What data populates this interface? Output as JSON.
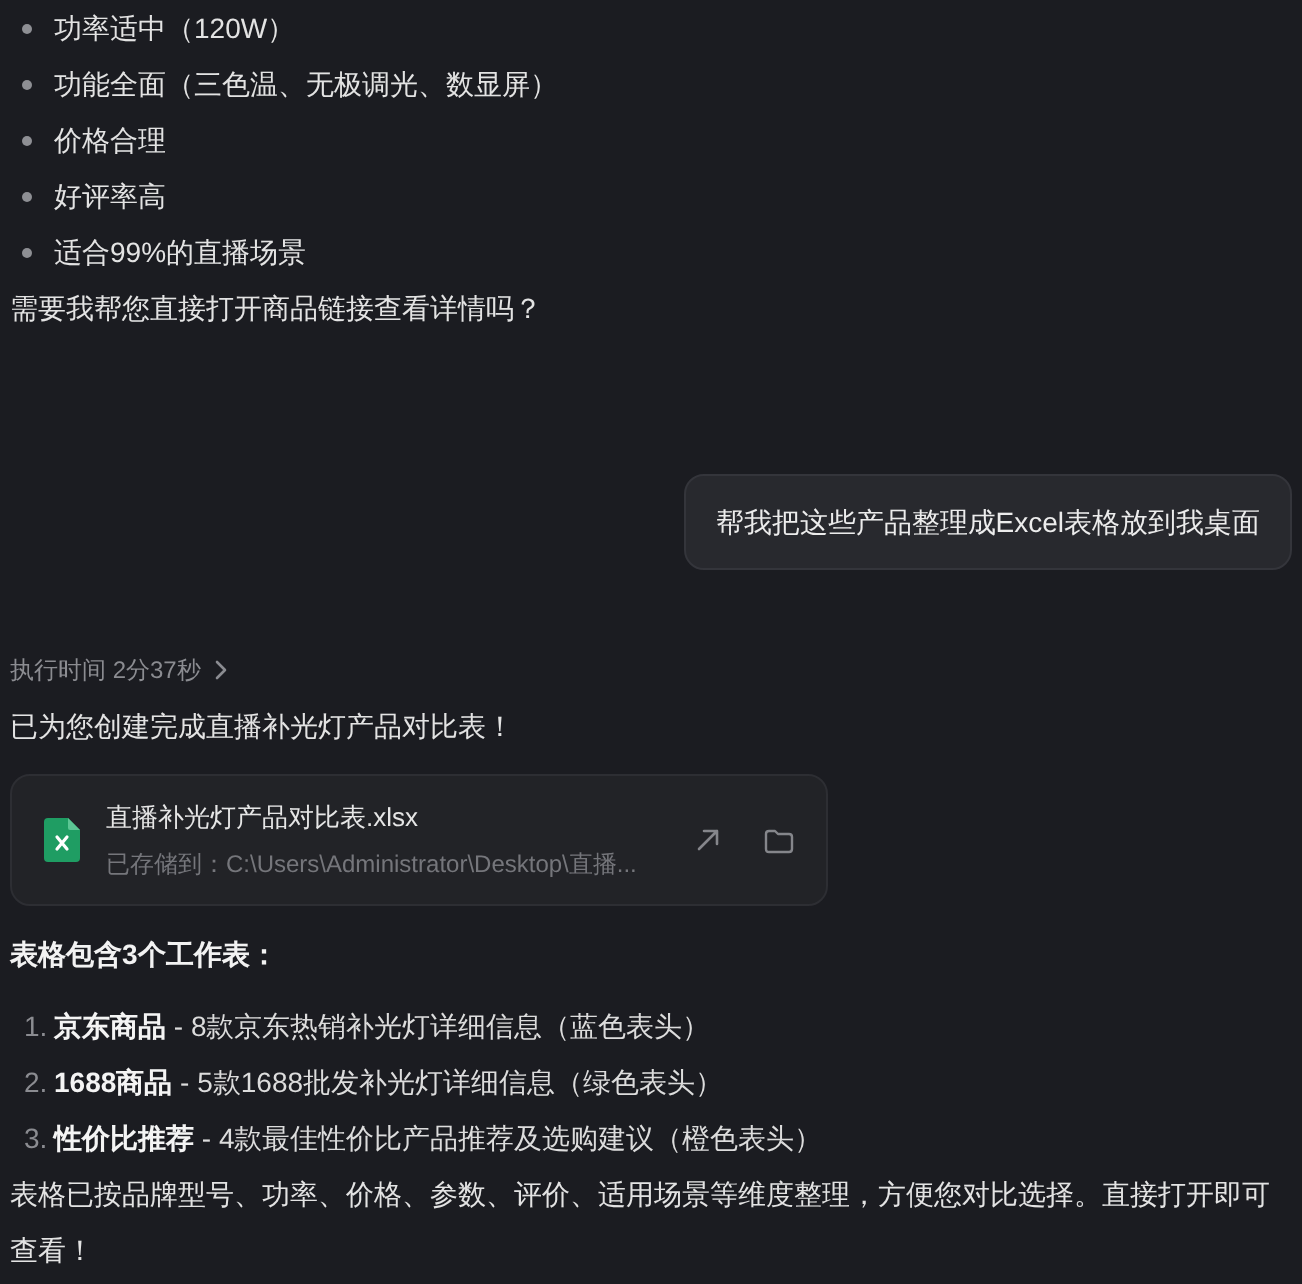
{
  "bullets": [
    "功率适中（120W）",
    "功能全面（三色温、无极调光、数显屏）",
    "价格合理",
    "好评率高",
    "适合99%的直播场景"
  ],
  "question": "需要我帮您直接打开商品链接查看详情吗？",
  "user_message": "帮我把这些产品整理成Excel表格放到我桌面",
  "execution_time": {
    "label": "执行时间 2分37秒",
    "expanded": false
  },
  "reply_intro": "已为您创建完成直播补光灯产品对比表！",
  "file": {
    "name": "直播补光灯产品对比表.xlsx",
    "path": "已存储到：C:\\Users\\Administrator\\Desktop\\直播..."
  },
  "sheets_heading": "表格包含3个工作表：",
  "sheets": [
    {
      "number": "1.",
      "text": "**京东商品** - 8款京东热销补光灯详细信息（蓝色表头）"
    },
    {
      "number": "2.",
      "text": "**1688商品** - 5款1688批发补光灯详细信息（绿色表头）"
    },
    {
      "number": "3.",
      "text": "**性价比推荐** - 4款最佳性价比产品推荐及选购建议（橙色表头）"
    }
  ],
  "summary": "表格已按品牌型号、功率、价格、参数、评价、适用场景等维度整理，方便您对比选择。直接打开即可查看！"
}
